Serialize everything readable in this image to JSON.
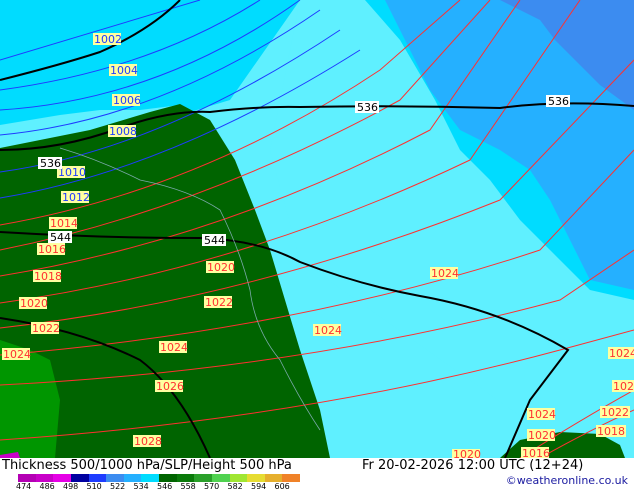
{
  "map": {
    "colors": {
      "light_cyan": "#5ff0ff",
      "cyan": "#00dcff",
      "light_blue": "#25b0ff",
      "blue": "#3c8cf0",
      "dark_green": "#006400",
      "green_edge": "#0a7a0a",
      "magenta_edge": "#c800c8",
      "isobar": "#ff3030",
      "height_line": "#000000",
      "label_bg": "#ffffa0"
    },
    "contour_labels": {
      "h_536_left": "536",
      "h_536_mid": "536",
      "h_536_right": "536",
      "h_544_left": "544",
      "h_544_mid": "544",
      "p_1002": "1002",
      "p_1004": "1004",
      "p_1006": "1006",
      "p_1008": "1008",
      "p_1010": "1010",
      "p_1012": "1012",
      "p_1014": "1014",
      "p_1016": "1016",
      "p_1018": "1018",
      "p_1020_a": "1020",
      "p_1020_b": "1020",
      "p_1020_c": "1020",
      "p_1022_a": "1022",
      "p_1022_b": "1022",
      "p_1022_c": "1022",
      "p_1024_a": "1024",
      "p_1024_b": "1024",
      "p_1024_c": "1024",
      "p_1024_d": "1024",
      "p_1024_e": "1024",
      "p_1024_f": "1024",
      "p_1026": "1026",
      "p_1028": "1028",
      "p_1018_r": "1018",
      "p_1016_r": "1016",
      "p_1020_r": "1020",
      "p_102_r": "102"
    }
  },
  "footer": {
    "title": "Thickness 500/1000 hPa/SLP/Height 500 hPa",
    "valid_time": "Fr 20-02-2026 12:00 UTC (12+24)",
    "credit": "©weatheronline.co.uk",
    "scale": {
      "colors": [
        "#b400b4",
        "#c800c8",
        "#e600e6",
        "#0000a0",
        "#1e3cff",
        "#3c8cf0",
        "#25b0ff",
        "#00dcff",
        "#006400",
        "#0a7a0a",
        "#2aa02a",
        "#50d250",
        "#a0e632",
        "#e6dc32",
        "#e6af2d",
        "#f08228"
      ],
      "ticks": [
        "474",
        "486",
        "498",
        "510",
        "522",
        "534",
        "546",
        "558",
        "570",
        "582",
        "594",
        "606"
      ]
    }
  }
}
